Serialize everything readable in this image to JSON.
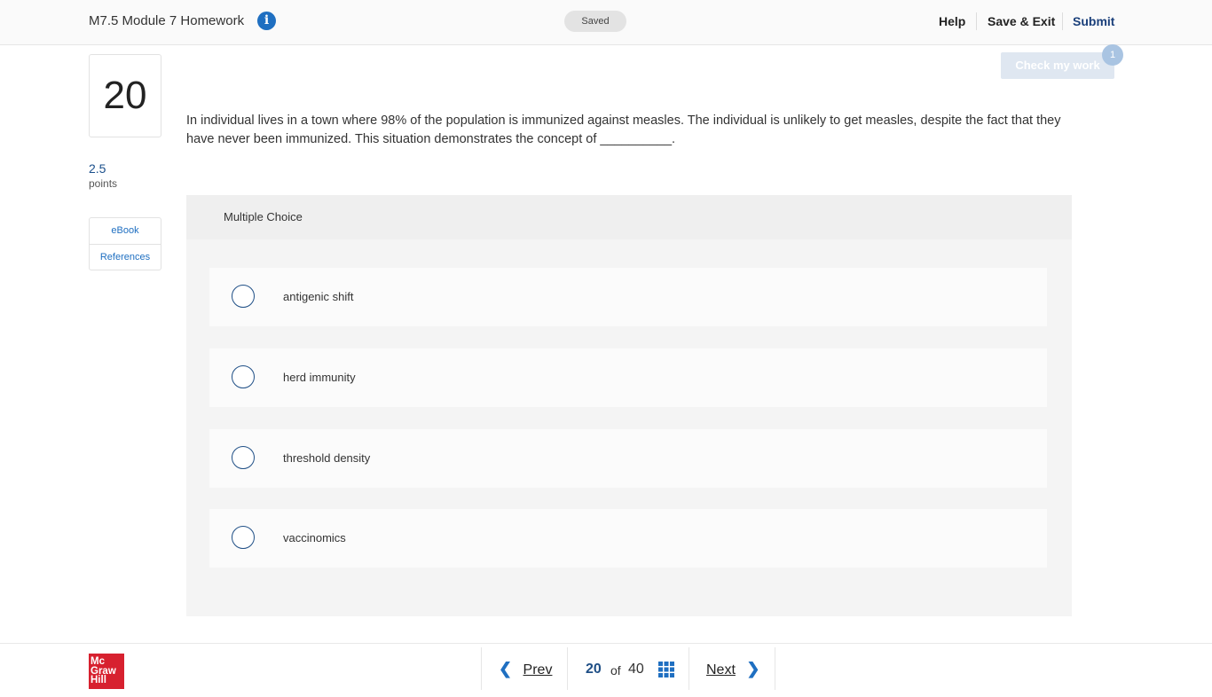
{
  "header": {
    "assignment_title": "M7.5 Module 7 Homework",
    "info_icon": "info-icon",
    "saved_status": "Saved",
    "help_label": "Help",
    "save_exit_label": "Save & Exit",
    "submit_label": "Submit"
  },
  "question": {
    "number": "20",
    "points_value": "2.5",
    "points_label": "points",
    "resources": [
      "eBook",
      "References"
    ],
    "text": "In individual lives in a town where 98% of the population is immunized against measles. The individual is unlikely to get measles, despite the fact that they have never been immunized. This situation demonstrates the concept of __________.",
    "type_label": "Multiple Choice",
    "choices": [
      "antigenic shift",
      "herd immunity",
      "threshold density",
      "vaccinomics"
    ]
  },
  "check_work": {
    "label": "Check my work",
    "badge_count": "1"
  },
  "footer": {
    "logo_lines": [
      "Mc",
      "Graw",
      "Hill"
    ],
    "prev_label": "Prev",
    "next_label": "Next",
    "current_page": "20",
    "of_label": "of",
    "total_pages": "40",
    "grid_icon": "grid-icon"
  },
  "colors": {
    "accent_blue": "#1f6fc1",
    "dark_blue": "#1f4f86",
    "brand_red": "#d7212f"
  }
}
